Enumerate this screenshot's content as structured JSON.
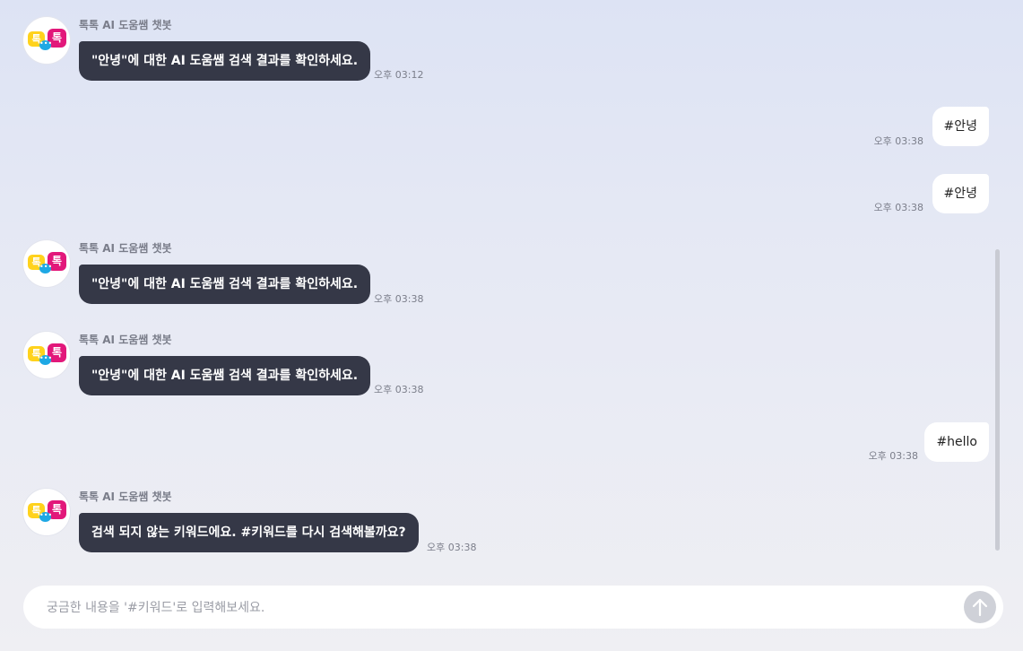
{
  "bot_name": "톡톡 AI 도움쌤 챗봇",
  "avatar": {
    "left_char": "톡",
    "right_char": "톡",
    "dots": "•••"
  },
  "messages": [
    {
      "sender": "bot",
      "text": "\"안녕\"에 대한 AI 도움쌤 검색 결과를 확인하세요.",
      "time": "오후 03:12"
    },
    {
      "sender": "user",
      "text": "#안녕",
      "time": "오후 03:38"
    },
    {
      "sender": "user",
      "text": "#안녕",
      "time": "오후 03:38"
    },
    {
      "sender": "bot",
      "text": "\"안녕\"에 대한 AI 도움쌤 검색 결과를 확인하세요.",
      "time": "오후 03:38"
    },
    {
      "sender": "bot",
      "text": "\"안녕\"에 대한 AI 도움쌤 검색 결과를 확인하세요.",
      "time": "오후 03:38"
    },
    {
      "sender": "user",
      "text": "#hello",
      "time": "오후 03:38"
    },
    {
      "sender": "bot",
      "text": "검색 되지 않는 키워드에요. #키워드를 다시 검색해볼까요?",
      "time": "오후 03:38"
    }
  ],
  "input": {
    "placeholder": "궁금한 내용을 '#키워드'로 입력해보세요.",
    "value": ""
  },
  "send_icon": "arrow-up-icon",
  "colors": {
    "bot_bubble": "#353847",
    "user_bubble": "#ffffff",
    "accent_yellow": "#ffd21c",
    "accent_pink": "#e2187a",
    "accent_blue": "#1ea8e4"
  }
}
